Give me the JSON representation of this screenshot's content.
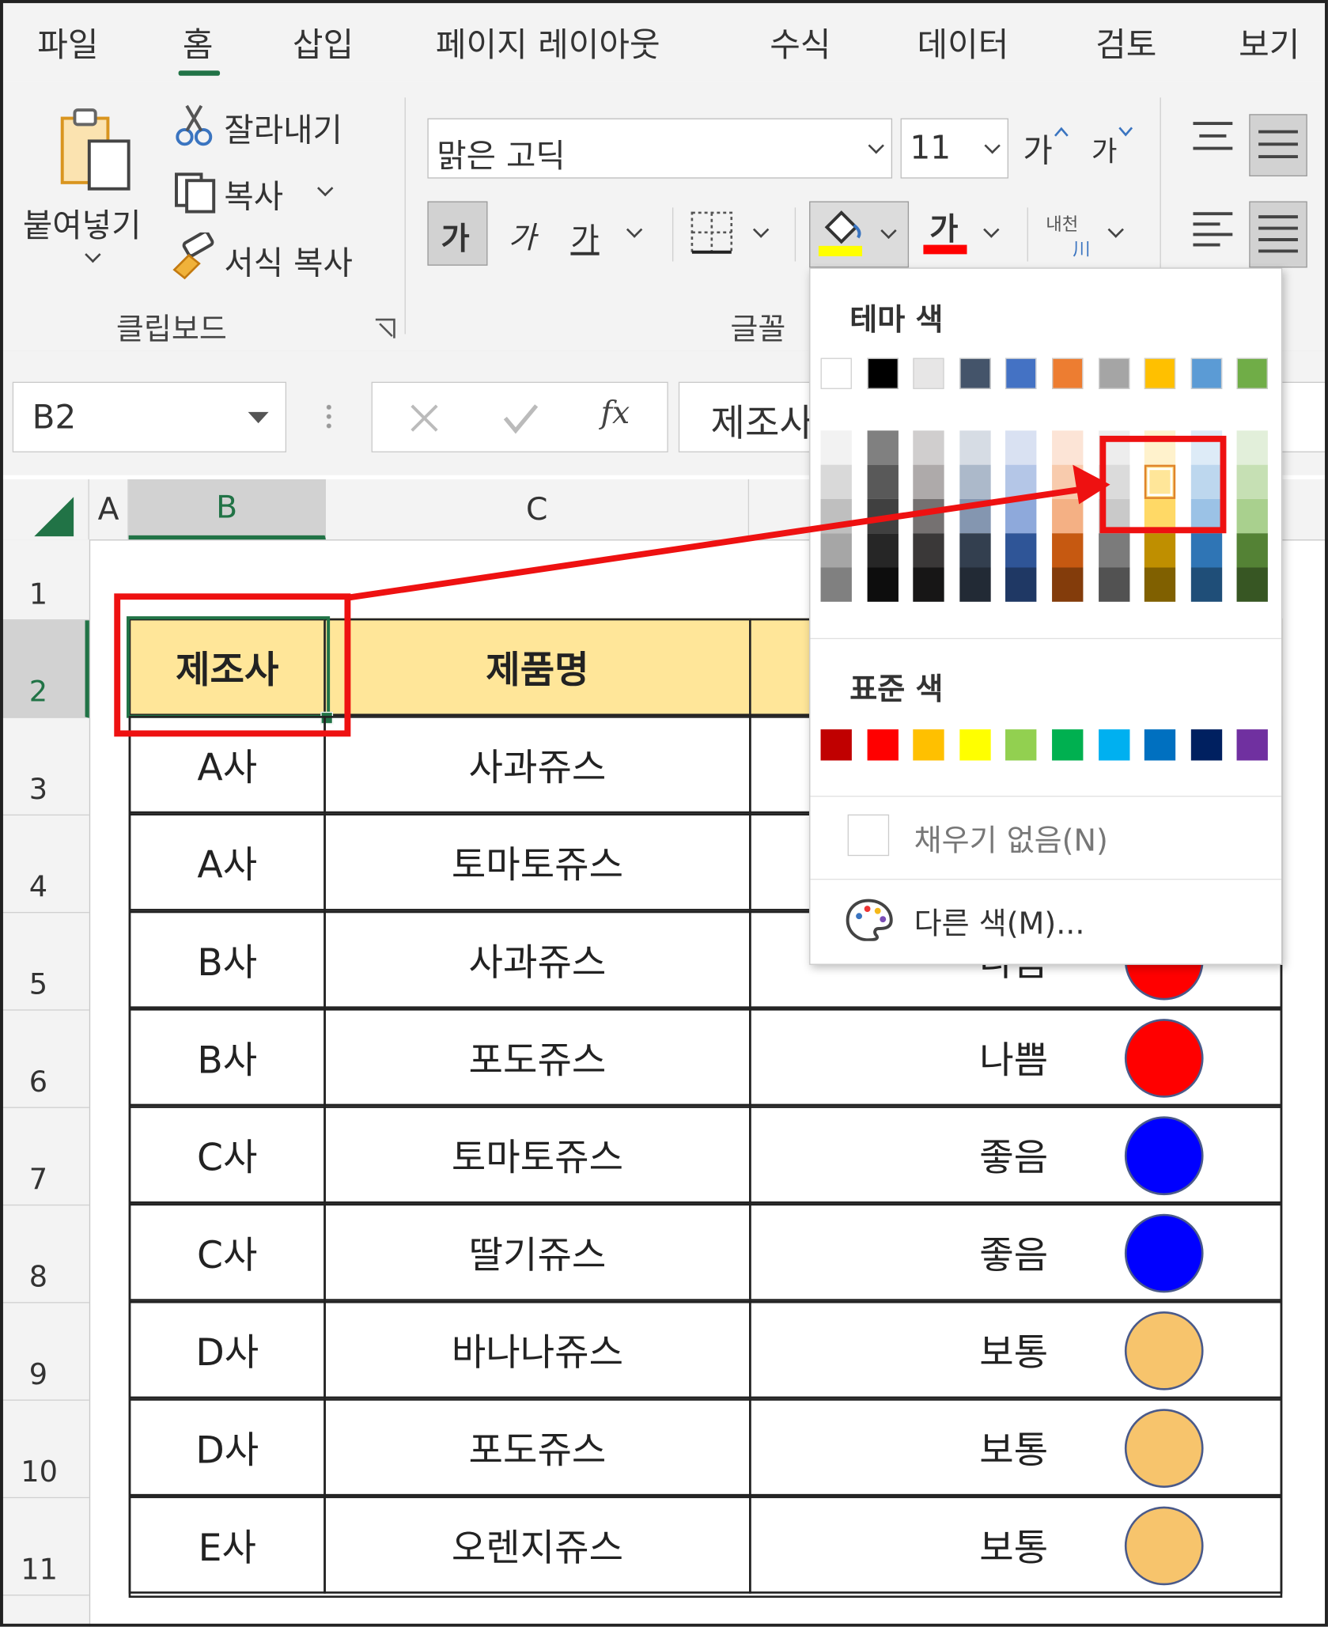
{
  "tabs": [
    "파일",
    "홈",
    "삽입",
    "페이지 레이아웃",
    "수식",
    "데이터",
    "검토",
    "보기"
  ],
  "active_tab": "홈",
  "clipboard": {
    "paste": "붙여넣기",
    "cut": "잘라내기",
    "copy": "복사",
    "format_painter": "서식 복사",
    "group_label": "클립보드"
  },
  "font": {
    "name": "맑은 고딕",
    "size": "11",
    "grow": "가",
    "shrink": "가",
    "bold": "가",
    "italic": "가",
    "underline": "가",
    "font_color_glyph": "가",
    "phonetic_top": "내천",
    "phonetic_bottom": "川",
    "group_label": "글꼴"
  },
  "formula_bar": {
    "name_box": "B2",
    "fx": "fx",
    "content": "제조사"
  },
  "columns": [
    "A",
    "B",
    "C"
  ],
  "rows": [
    "1",
    "2",
    "3",
    "4",
    "5",
    "6",
    "7",
    "8",
    "9",
    "10",
    "11"
  ],
  "table": {
    "headers": [
      "제조사",
      "제품명"
    ],
    "rows": [
      {
        "maker": "A사",
        "product": "사과쥬스",
        "status": "",
        "dot": ""
      },
      {
        "maker": "A사",
        "product": "토마토쥬스",
        "status": "",
        "dot": ""
      },
      {
        "maker": "B사",
        "product": "사과쥬스",
        "status": "나쁨",
        "dot": "#ff0000"
      },
      {
        "maker": "B사",
        "product": "포도쥬스",
        "status": "나쁨",
        "dot": "#ff0000"
      },
      {
        "maker": "C사",
        "product": "토마토쥬스",
        "status": "좋음",
        "dot": "#0000ff"
      },
      {
        "maker": "C사",
        "product": "딸기쥬스",
        "status": "좋음",
        "dot": "#0000ff"
      },
      {
        "maker": "D사",
        "product": "바나나쥬스",
        "status": "보통",
        "dot": "#f7c46c"
      },
      {
        "maker": "D사",
        "product": "포도쥬스",
        "status": "보통",
        "dot": "#f7c46c"
      },
      {
        "maker": "E사",
        "product": "오렌지쥬스",
        "status": "보통",
        "dot": "#f7c46c"
      }
    ]
  },
  "color_picker": {
    "theme_title": "테마 색",
    "theme_colors": [
      "#ffffff",
      "#000000",
      "#e7e6e6",
      "#44546a",
      "#4472c4",
      "#ed7d31",
      "#a5a5a5",
      "#ffc000",
      "#5b9bd5",
      "#70ad47"
    ],
    "shade_columns": [
      [
        "#f2f2f2",
        "#d9d9d9",
        "#bfbfbf",
        "#a6a6a6",
        "#808080"
      ],
      [
        "#808080",
        "#595959",
        "#404040",
        "#262626",
        "#0d0d0d"
      ],
      [
        "#d0cece",
        "#aeaaaa",
        "#757171",
        "#3a3838",
        "#171616"
      ],
      [
        "#d6dce4",
        "#acb9ca",
        "#8496b0",
        "#333f4f",
        "#222a35"
      ],
      [
        "#d9e1f2",
        "#b4c6e7",
        "#8ea9db",
        "#2f5597",
        "#1f3864"
      ],
      [
        "#fce4d6",
        "#f8cbad",
        "#f4b084",
        "#c65911",
        "#833c0b"
      ],
      [
        "#ededed",
        "#dbdbdb",
        "#c9c9c9",
        "#7b7b7b",
        "#525252"
      ],
      [
        "#fff2cc",
        "#ffe699",
        "#ffd966",
        "#bf8f00",
        "#806000"
      ],
      [
        "#ddebf7",
        "#bdd7ee",
        "#9bc2e6",
        "#2f75b5",
        "#1f4e78"
      ],
      [
        "#e2efda",
        "#c6e0b4",
        "#a9d08e",
        "#548235",
        "#375623"
      ]
    ],
    "selected_color": "#ffe699",
    "standard_title": "표준 색",
    "standard_colors": [
      "#c00000",
      "#ff0000",
      "#ffc000",
      "#ffff00",
      "#92d050",
      "#00b050",
      "#00b0f0",
      "#0070c0",
      "#002060",
      "#7030a0"
    ],
    "no_fill": "채우기 없음(N)",
    "more_colors": "다른 색(M)...",
    "annotation_color": "#ee1111"
  }
}
